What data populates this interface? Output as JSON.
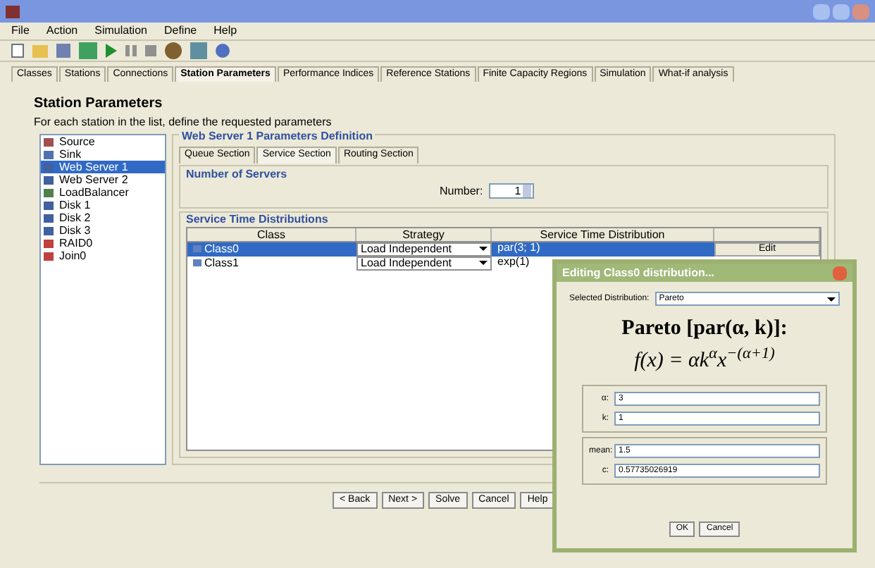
{
  "menu": [
    "File",
    "Action",
    "Simulation",
    "Define",
    "Help"
  ],
  "tabs": [
    {
      "label": "Classes",
      "selected": false
    },
    {
      "label": "Stations",
      "selected": false
    },
    {
      "label": "Connections",
      "selected": false
    },
    {
      "label": "Station Parameters",
      "selected": true
    },
    {
      "label": "Performance Indices",
      "selected": false
    },
    {
      "label": "Reference Stations",
      "selected": false
    },
    {
      "label": "Finite Capacity Regions",
      "selected": false
    },
    {
      "label": "Simulation",
      "selected": false
    },
    {
      "label": "What-if analysis",
      "selected": false
    }
  ],
  "heading": "Station Parameters",
  "subheading": "For each station in the list, define the requested parameters",
  "stations": [
    {
      "label": "Source",
      "kind": "source",
      "selected": false
    },
    {
      "label": "Sink",
      "kind": "sink",
      "selected": false
    },
    {
      "label": "Web Server 1",
      "kind": "server",
      "selected": true
    },
    {
      "label": "Web Server 2",
      "kind": "server",
      "selected": false
    },
    {
      "label": "LoadBalancer",
      "kind": "router",
      "selected": false
    },
    {
      "label": "Disk 1",
      "kind": "server",
      "selected": false
    },
    {
      "label": "Disk 2",
      "kind": "server",
      "selected": false
    },
    {
      "label": "Disk 3",
      "kind": "server",
      "selected": false
    },
    {
      "label": "RAID0",
      "kind": "fork",
      "selected": false
    },
    {
      "label": "Join0",
      "kind": "fork",
      "selected": false
    }
  ],
  "panel_title": "Web Server 1 Parameters Definition",
  "sub_tabs": [
    {
      "label": "Queue Section",
      "selected": false
    },
    {
      "label": "Service Section",
      "selected": true
    },
    {
      "label": "Routing Section",
      "selected": false
    }
  ],
  "servers": {
    "title": "Number of Servers",
    "label": "Number:",
    "value": "1"
  },
  "service": {
    "title": "Service Time Distributions",
    "columns": [
      "Class",
      "Strategy",
      "Service Time Distribution"
    ],
    "rows": [
      {
        "class": "Class0",
        "strategy": "Load Independent",
        "distribution": "par(3; 1)",
        "action": "Edit",
        "selected": true
      },
      {
        "class": "Class1",
        "strategy": "Load Independent",
        "distribution": "exp(1)",
        "selected": false
      }
    ]
  },
  "dialog": {
    "title": "Editing Class0 distribution...",
    "dist_label": "Selected Distribution:",
    "dist_value": "Pareto",
    "formula_title": "Pareto [par(α, k)]:",
    "formula": "f(x) = αk$^{α}$x$^{−(α+1)}$",
    "params": [
      {
        "label": "α:",
        "value": "3"
      },
      {
        "label": "k:",
        "value": "1"
      }
    ],
    "stats": [
      {
        "label": "mean:",
        "value": "1.5"
      },
      {
        "label": "c:",
        "value": "0.57735026919"
      }
    ],
    "buttons": [
      "OK",
      "Cancel"
    ]
  },
  "footer_buttons": [
    "< Back",
    "Next >",
    "Solve",
    "Cancel",
    "Help"
  ]
}
